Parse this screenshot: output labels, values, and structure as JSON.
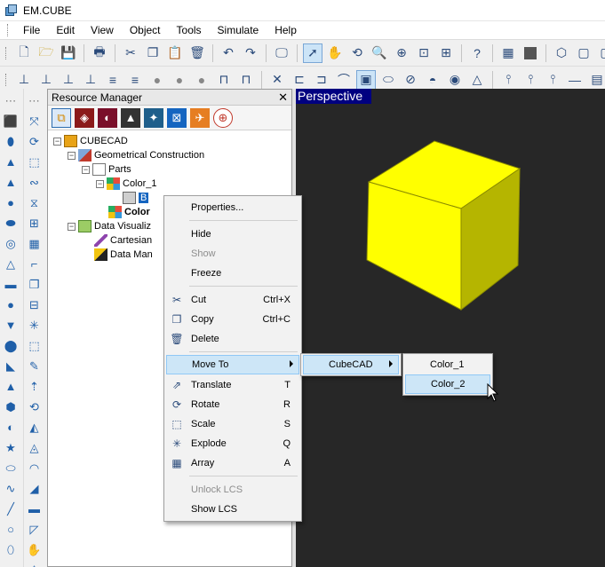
{
  "window": {
    "title": "EM.CUBE"
  },
  "menu": [
    "File",
    "Edit",
    "View",
    "Object",
    "Tools",
    "Simulate",
    "Help"
  ],
  "resource_manager": {
    "title": "Resource Manager",
    "close_glyph": "✕",
    "tree": {
      "root": "CUBECAD",
      "geometrical_construction": "Geometrical Construction",
      "parts": "Parts",
      "color_1": "Color_1",
      "selected_object": "B",
      "color_2": "Color",
      "data_visualization": "Data Visualiz",
      "cartesian": "Cartesian",
      "data_manager": "Data Man"
    }
  },
  "viewport": {
    "label": "Perspective",
    "background_color": "#272727",
    "cube_color": "#ffff00"
  },
  "context_menu": {
    "items": [
      {
        "label": "Properties...",
        "shortcut": "",
        "icon": ""
      },
      {
        "label": "Hide",
        "shortcut": "",
        "icon": ""
      },
      {
        "label": "Show",
        "shortcut": "",
        "icon": "",
        "disabled": true
      },
      {
        "label": "Freeze",
        "shortcut": "",
        "icon": ""
      },
      {
        "label": "Cut",
        "shortcut": "Ctrl+X",
        "icon": "scissors-icon"
      },
      {
        "label": "Copy",
        "shortcut": "Ctrl+C",
        "icon": "copy-icon"
      },
      {
        "label": "Delete",
        "shortcut": "",
        "icon": "trash-icon"
      },
      {
        "label": "Move To",
        "shortcut": "",
        "icon": "",
        "submenu": true
      },
      {
        "label": "Translate",
        "shortcut": "T",
        "icon": "translate-icon"
      },
      {
        "label": "Rotate",
        "shortcut": "R",
        "icon": "rotate-icon"
      },
      {
        "label": "Scale",
        "shortcut": "S",
        "icon": "scale-icon"
      },
      {
        "label": "Explode",
        "shortcut": "Q",
        "icon": "explode-icon"
      },
      {
        "label": "Array",
        "shortcut": "A",
        "icon": "array-icon"
      },
      {
        "label": "Unlock LCS",
        "shortcut": "",
        "icon": "",
        "disabled": true
      },
      {
        "label": "Show LCS",
        "shortcut": "",
        "icon": ""
      }
    ],
    "move_to_submenu": {
      "label": "CubeCAD"
    },
    "cubecad_submenu": [
      "Color_1",
      "Color_2"
    ]
  }
}
